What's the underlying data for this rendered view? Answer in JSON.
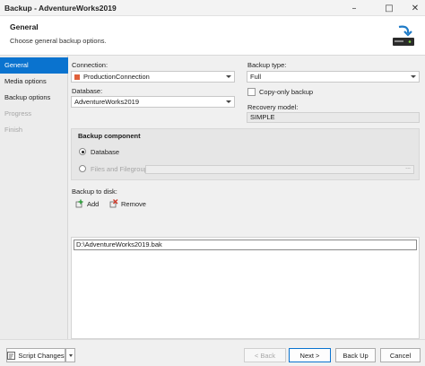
{
  "window": {
    "title": "Backup - AdventureWorks2019"
  },
  "header": {
    "title": "General",
    "subtitle": "Choose general backup options."
  },
  "sidebar": {
    "items": [
      {
        "label": "General",
        "state": "active"
      },
      {
        "label": "Media options",
        "state": "normal"
      },
      {
        "label": "Backup options",
        "state": "normal"
      },
      {
        "label": "Progress",
        "state": "disabled"
      },
      {
        "label": "Finish",
        "state": "disabled"
      }
    ]
  },
  "form": {
    "connection_label": "Connection:",
    "connection_value": "ProductionConnection",
    "database_label": "Database:",
    "database_value": "AdventureWorks2019",
    "backup_type_label": "Backup type:",
    "backup_type_value": "Full",
    "copy_only_label": "Copy-only backup",
    "copy_only_checked": false,
    "recovery_model_label": "Recovery model:",
    "recovery_model_value": "SIMPLE"
  },
  "backup_component": {
    "title": "Backup component",
    "database_option": "Database",
    "files_option": "Files and Filegroups",
    "selected": "Database",
    "files_browse": "..."
  },
  "backup_to_disk": {
    "label": "Backup to disk:",
    "add_label": "Add",
    "remove_label": "Remove",
    "paths": [
      "D:\\AdventureWorks2019.bak"
    ]
  },
  "footer": {
    "script_changes_label": "Script Changes",
    "back_label": "< Back",
    "next_label": "Next >",
    "backup_label": "Back Up",
    "cancel_label": "Cancel"
  },
  "colors": {
    "accent": "#0a73cf",
    "connection_marker": "#e0603a",
    "add_icon": "#2e9d3a",
    "remove_icon": "#d23c2c"
  }
}
